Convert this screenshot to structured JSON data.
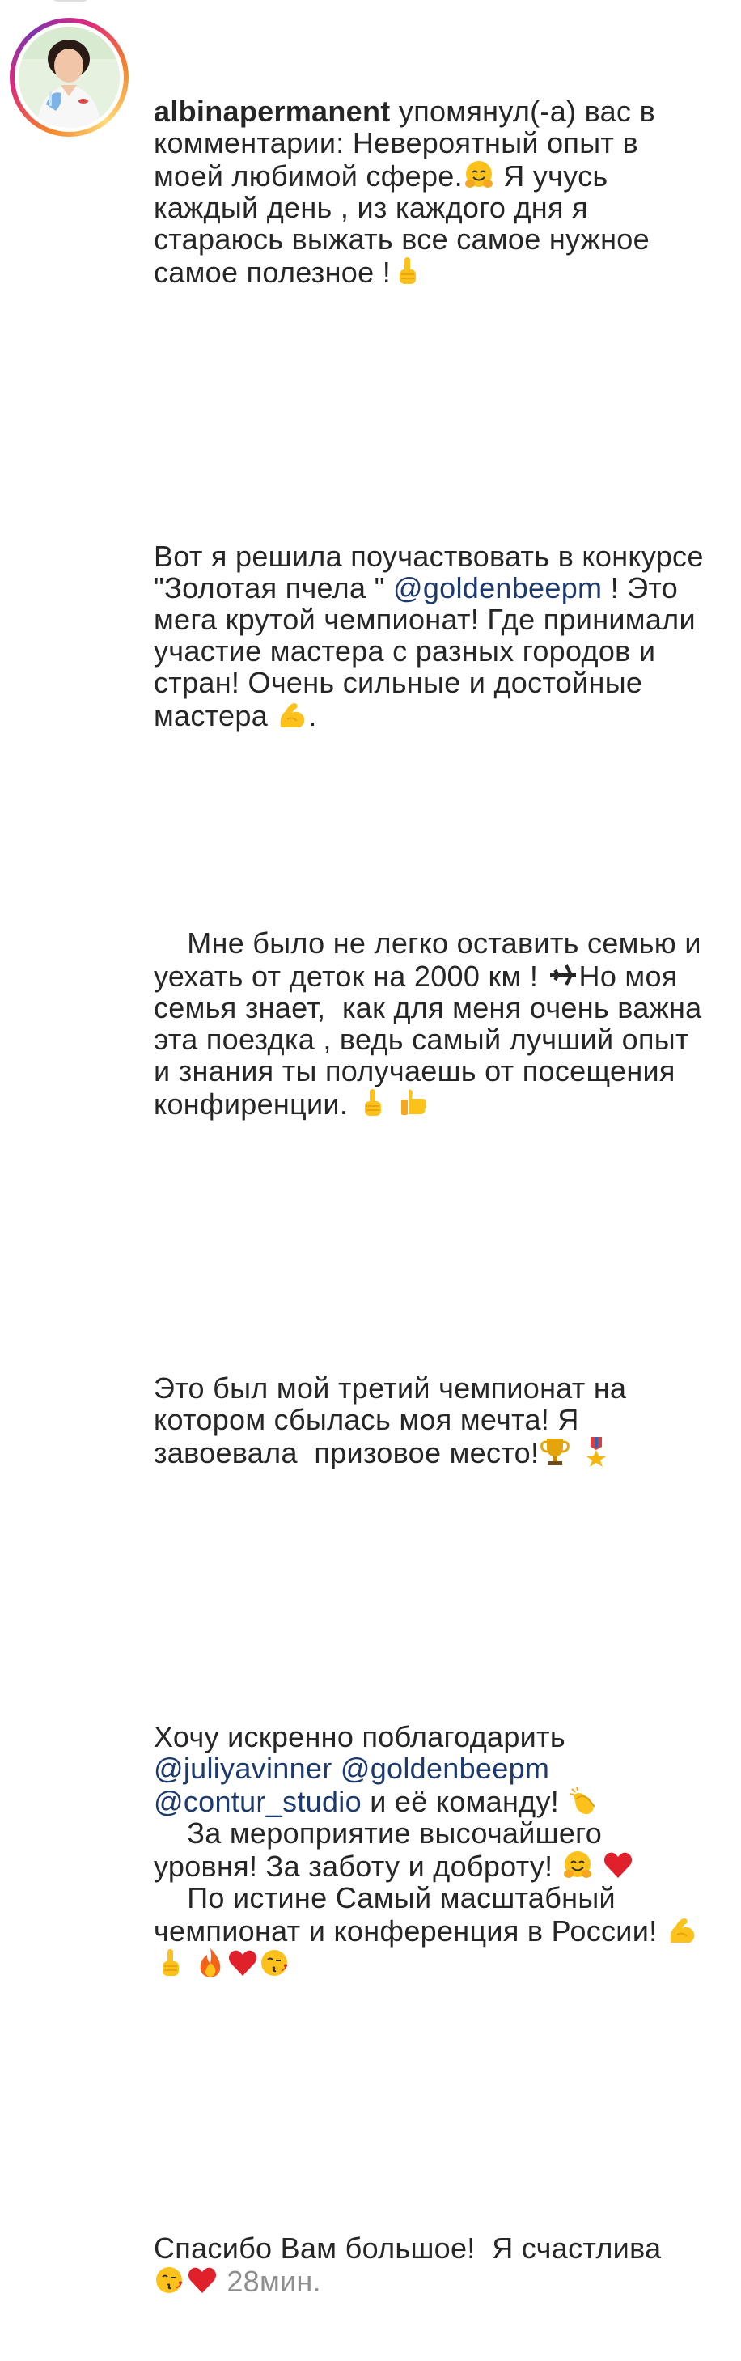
{
  "notification": {
    "username": "albinapermanent",
    "action": "упомянул(-а) вас в комментарии:",
    "time": "28мин."
  },
  "comment": {
    "p1_a": "Невероятный опыт в моей любимой сфере.",
    "p1_b": " Я учусь каждый день , из каждого дня я стараюсь выжать все самое нужное самое полезное !",
    "p2_a": "Вот я решила поучаствовать в конкурсе \"Золотая пчела \" ",
    "mention_goldenbeepm": "@goldenbeepm",
    "p2_b": " ! Это мега крутой чемпионат! Где принимали участие мастера с разных городов и стран! Очень сильные и достойные мастера ",
    "p2_c": ".",
    "p3_a": "    Мне было не легко оставить семью и уехать от деток на 2000 км ! ",
    "p3_b": "Но моя семья знает,  как для меня очень важна эта поездка , ведь самый лучший опыт и знания ты получаешь от посещения конфиренции. ",
    "p4_a": "Это был мой третий чемпионат на котором сбылась моя мечта! Я завоевала  призовое место!",
    "p5_a": "Хочу искренно поблагодарить ",
    "mention_juliyavinner": "@juliyavinner",
    "mention_goldenbeepm_2": "@goldenbeepm",
    "mention_contur_studio": "@contur_studio",
    "p5_b": " и её команду! ",
    "p5_c": "За мероприятие высочайшего уровня! За заботу и доброту! ",
    "p5_d": "По истине Самый масштабный чемпионат и конференция в России! ",
    "p6_a": "Спасибо Вам большое!  Я счастлива"
  },
  "icons": {
    "avatar": "profile-photo",
    "hugging": "hugging-face-emoji",
    "point_up": "index-pointing-up-emoji",
    "biceps": "flexed-biceps-emoji",
    "airplane": "airplane-glyph",
    "thumbs_up": "thumbs-up-emoji",
    "trophy": "trophy-emoji",
    "medal": "military-medal-emoji",
    "clap": "clapping-hands-emoji",
    "heart": "red-heart-emoji",
    "fire": "fire-emoji",
    "kiss": "face-blowing-kiss-emoji"
  },
  "colors": {
    "text": "#262626",
    "mention": "#1d3a6e",
    "time": "#8e8e8e",
    "ring_start": "#f58529",
    "ring_mid": "#dd2a7b",
    "ring_end": "#8134af"
  }
}
